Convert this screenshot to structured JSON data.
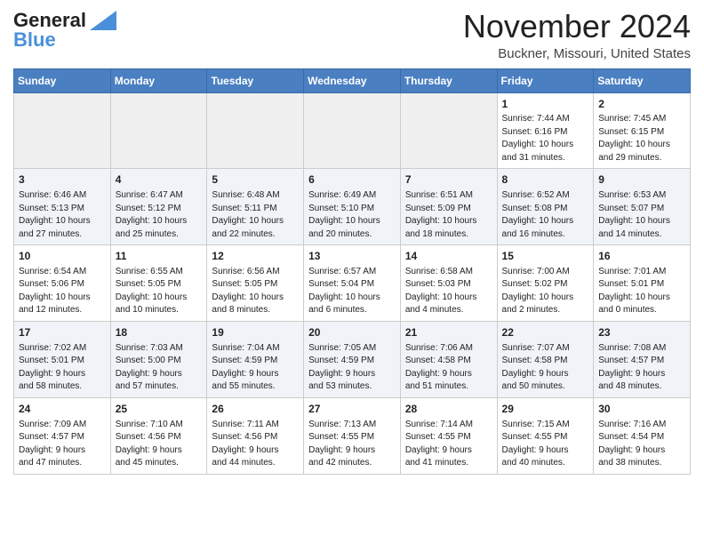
{
  "header": {
    "logo_line1": "General",
    "logo_line2": "Blue",
    "month": "November 2024",
    "location": "Buckner, Missouri, United States"
  },
  "days_of_week": [
    "Sunday",
    "Monday",
    "Tuesday",
    "Wednesday",
    "Thursday",
    "Friday",
    "Saturday"
  ],
  "weeks": [
    {
      "days": [
        {
          "date": "",
          "info": ""
        },
        {
          "date": "",
          "info": ""
        },
        {
          "date": "",
          "info": ""
        },
        {
          "date": "",
          "info": ""
        },
        {
          "date": "",
          "info": ""
        },
        {
          "date": "1",
          "info": "Sunrise: 7:44 AM\nSunset: 6:16 PM\nDaylight: 10 hours\nand 31 minutes."
        },
        {
          "date": "2",
          "info": "Sunrise: 7:45 AM\nSunset: 6:15 PM\nDaylight: 10 hours\nand 29 minutes."
        }
      ]
    },
    {
      "days": [
        {
          "date": "3",
          "info": "Sunrise: 6:46 AM\nSunset: 5:13 PM\nDaylight: 10 hours\nand 27 minutes."
        },
        {
          "date": "4",
          "info": "Sunrise: 6:47 AM\nSunset: 5:12 PM\nDaylight: 10 hours\nand 25 minutes."
        },
        {
          "date": "5",
          "info": "Sunrise: 6:48 AM\nSunset: 5:11 PM\nDaylight: 10 hours\nand 22 minutes."
        },
        {
          "date": "6",
          "info": "Sunrise: 6:49 AM\nSunset: 5:10 PM\nDaylight: 10 hours\nand 20 minutes."
        },
        {
          "date": "7",
          "info": "Sunrise: 6:51 AM\nSunset: 5:09 PM\nDaylight: 10 hours\nand 18 minutes."
        },
        {
          "date": "8",
          "info": "Sunrise: 6:52 AM\nSunset: 5:08 PM\nDaylight: 10 hours\nand 16 minutes."
        },
        {
          "date": "9",
          "info": "Sunrise: 6:53 AM\nSunset: 5:07 PM\nDaylight: 10 hours\nand 14 minutes."
        }
      ]
    },
    {
      "days": [
        {
          "date": "10",
          "info": "Sunrise: 6:54 AM\nSunset: 5:06 PM\nDaylight: 10 hours\nand 12 minutes."
        },
        {
          "date": "11",
          "info": "Sunrise: 6:55 AM\nSunset: 5:05 PM\nDaylight: 10 hours\nand 10 minutes."
        },
        {
          "date": "12",
          "info": "Sunrise: 6:56 AM\nSunset: 5:05 PM\nDaylight: 10 hours\nand 8 minutes."
        },
        {
          "date": "13",
          "info": "Sunrise: 6:57 AM\nSunset: 5:04 PM\nDaylight: 10 hours\nand 6 minutes."
        },
        {
          "date": "14",
          "info": "Sunrise: 6:58 AM\nSunset: 5:03 PM\nDaylight: 10 hours\nand 4 minutes."
        },
        {
          "date": "15",
          "info": "Sunrise: 7:00 AM\nSunset: 5:02 PM\nDaylight: 10 hours\nand 2 minutes."
        },
        {
          "date": "16",
          "info": "Sunrise: 7:01 AM\nSunset: 5:01 PM\nDaylight: 10 hours\nand 0 minutes."
        }
      ]
    },
    {
      "days": [
        {
          "date": "17",
          "info": "Sunrise: 7:02 AM\nSunset: 5:01 PM\nDaylight: 9 hours\nand 58 minutes."
        },
        {
          "date": "18",
          "info": "Sunrise: 7:03 AM\nSunset: 5:00 PM\nDaylight: 9 hours\nand 57 minutes."
        },
        {
          "date": "19",
          "info": "Sunrise: 7:04 AM\nSunset: 4:59 PM\nDaylight: 9 hours\nand 55 minutes."
        },
        {
          "date": "20",
          "info": "Sunrise: 7:05 AM\nSunset: 4:59 PM\nDaylight: 9 hours\nand 53 minutes."
        },
        {
          "date": "21",
          "info": "Sunrise: 7:06 AM\nSunset: 4:58 PM\nDaylight: 9 hours\nand 51 minutes."
        },
        {
          "date": "22",
          "info": "Sunrise: 7:07 AM\nSunset: 4:58 PM\nDaylight: 9 hours\nand 50 minutes."
        },
        {
          "date": "23",
          "info": "Sunrise: 7:08 AM\nSunset: 4:57 PM\nDaylight: 9 hours\nand 48 minutes."
        }
      ]
    },
    {
      "days": [
        {
          "date": "24",
          "info": "Sunrise: 7:09 AM\nSunset: 4:57 PM\nDaylight: 9 hours\nand 47 minutes."
        },
        {
          "date": "25",
          "info": "Sunrise: 7:10 AM\nSunset: 4:56 PM\nDaylight: 9 hours\nand 45 minutes."
        },
        {
          "date": "26",
          "info": "Sunrise: 7:11 AM\nSunset: 4:56 PM\nDaylight: 9 hours\nand 44 minutes."
        },
        {
          "date": "27",
          "info": "Sunrise: 7:13 AM\nSunset: 4:55 PM\nDaylight: 9 hours\nand 42 minutes."
        },
        {
          "date": "28",
          "info": "Sunrise: 7:14 AM\nSunset: 4:55 PM\nDaylight: 9 hours\nand 41 minutes."
        },
        {
          "date": "29",
          "info": "Sunrise: 7:15 AM\nSunset: 4:55 PM\nDaylight: 9 hours\nand 40 minutes."
        },
        {
          "date": "30",
          "info": "Sunrise: 7:16 AM\nSunset: 4:54 PM\nDaylight: 9 hours\nand 38 minutes."
        }
      ]
    }
  ]
}
